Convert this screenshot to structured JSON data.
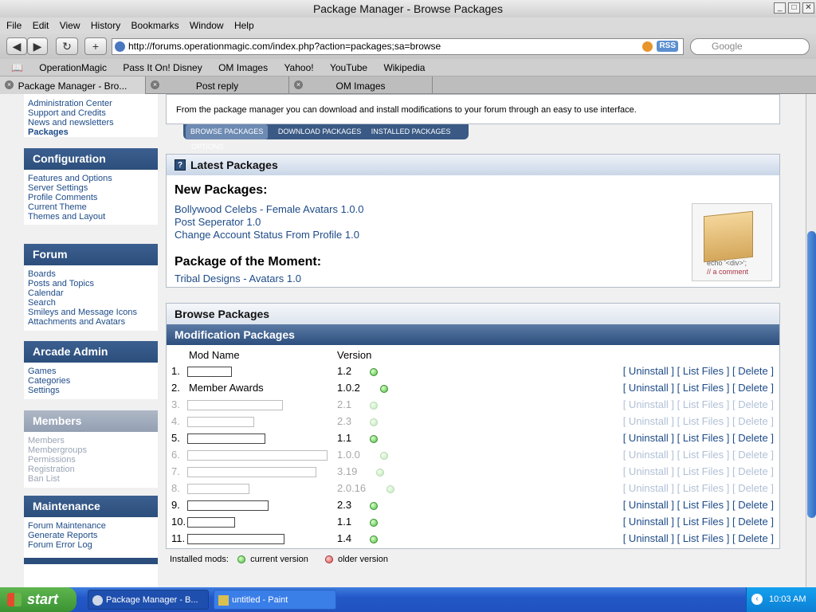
{
  "window": {
    "title": "Package Manager - Browse Packages"
  },
  "menu": [
    "File",
    "Edit",
    "View",
    "History",
    "Bookmarks",
    "Window",
    "Help"
  ],
  "nav": {
    "url": "http://forums.operationmagic.com/index.php?action=packages;sa=browse",
    "rss": "RSS",
    "search_placeholder": "Google"
  },
  "bookmarks": [
    "OperationMagic",
    "Pass It On! Disney",
    "OM Images",
    "Yahoo!",
    "YouTube",
    "Wikipedia"
  ],
  "tabs": [
    "Package Manager - Bro...",
    "Post reply",
    "OM Images"
  ],
  "sidebar": {
    "top_links": [
      "Administration Center",
      "Support and Credits",
      "News and newsletters",
      "Packages"
    ],
    "sections": [
      {
        "title": "Configuration",
        "links": [
          "Features and Options",
          "Server Settings",
          "Profile Comments",
          "Current Theme",
          "Themes and Layout"
        ]
      },
      {
        "title": "Forum",
        "links": [
          "Boards",
          "Posts and Topics",
          "Calendar",
          "Search",
          "Smileys and Message Icons",
          "Attachments and Avatars"
        ]
      },
      {
        "title": "Arcade Admin",
        "links": [
          "Games",
          "Categories",
          "Settings"
        ]
      },
      {
        "title": "Members",
        "links": [
          "Members",
          "Membergroups",
          "Permissions",
          "Registration",
          "Ban List"
        ]
      },
      {
        "title": "Maintenance",
        "links": [
          "Forum Maintenance",
          "Generate Reports",
          "Forum Error Log"
        ]
      }
    ]
  },
  "main": {
    "intro": "From the package manager you can download and install modifications to your forum through an easy to use interface.",
    "pkg_tabs": [
      "BROWSE PACKAGES",
      "DOWNLOAD PACKAGES",
      "INSTALLED PACKAGES",
      "OPTIONS"
    ],
    "latest_title": "Latest Packages",
    "new_title": "New Packages:",
    "new_packages": [
      "Bollywood Celebs - Female Avatars 1.0.0",
      "Post Seperator 1.0",
      "Change Account Status From Profile 1.0"
    ],
    "moment_title": "Package of the Moment:",
    "moment_package": "Tribal Designs - Avatars 1.0",
    "box_caption_1": "echo '<div>';",
    "box_caption_2": "// a comment",
    "browse_title": "Browse Packages",
    "mods_title": "Modification Packages",
    "col_name": "Mod Name",
    "col_version": "Version",
    "actions": "[ Uninstall ] [ List Files ] [ Delete ]",
    "mods": [
      {
        "num": "1.",
        "name": "",
        "version": "1.2"
      },
      {
        "num": "2.",
        "name": "Member Awards",
        "version": "1.0.2"
      },
      {
        "num": "3.",
        "name": "",
        "version": "2.1"
      },
      {
        "num": "4.",
        "name": "",
        "version": "2.3"
      },
      {
        "num": "5.",
        "name": "",
        "version": "1.1"
      },
      {
        "num": "6.",
        "name": "",
        "version": "1.0.0"
      },
      {
        "num": "7.",
        "name": "",
        "version": "3.19"
      },
      {
        "num": "8.",
        "name": "",
        "version": "2.0.16"
      },
      {
        "num": "9.",
        "name": "",
        "version": "2.3"
      },
      {
        "num": "10.",
        "name": "",
        "version": "1.1"
      },
      {
        "num": "11.",
        "name": "",
        "version": "1.4"
      }
    ],
    "legend_label": "Installed mods:",
    "legend_current": "current version",
    "legend_older": "older version"
  },
  "taskbar": {
    "start": "start",
    "items": [
      "Package Manager - B...",
      "untitled - Paint"
    ],
    "clock": "10:03 AM"
  }
}
